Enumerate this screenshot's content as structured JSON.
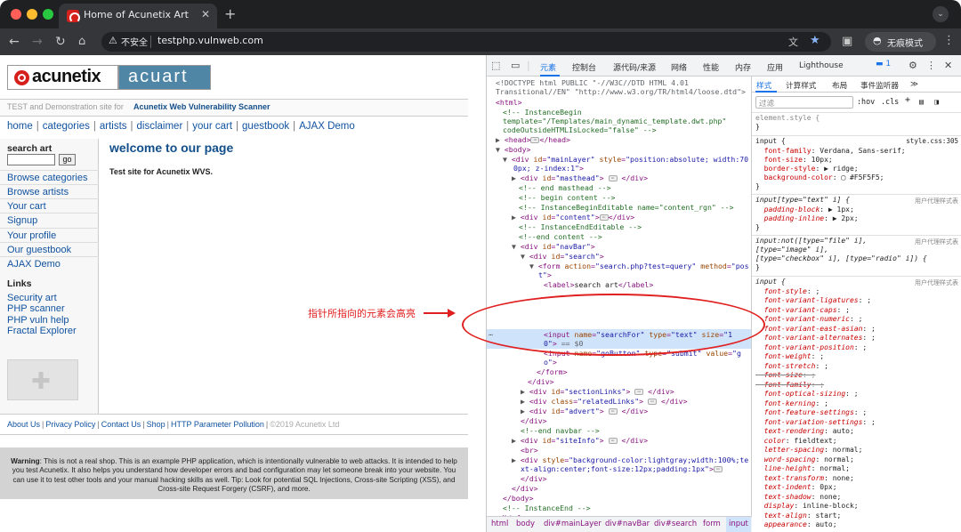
{
  "browser": {
    "tab_title": "Home of Acunetix Art",
    "insecure_label": "不安全",
    "url": "testphp.vulnweb.com",
    "incognito_label": "无痕模式",
    "icons": {
      "back": "back-icon",
      "forward": "forward-icon",
      "reload": "reload-icon",
      "home": "home-icon",
      "warning": "warning-icon",
      "translate": "translate-icon",
      "star": "star-icon",
      "side_panel": "side-panel-icon",
      "incognito": "incognito-icon",
      "menu": "menu-icon",
      "close": "close-icon",
      "new_tab": "plus-icon",
      "tab_dropdown": "chevron-down-icon"
    }
  },
  "site": {
    "logo_left": "acunetix",
    "logo_right": "acuart",
    "tagline_a": "TEST and Demonstration site for",
    "tagline_b": "Acunetix Web Vulnerability Scanner",
    "topnav": [
      "home",
      "categories",
      "artists",
      "disclaimer",
      "your cart",
      "guestbook",
      "AJAX Demo"
    ],
    "search_label": "search art",
    "go_label": "go",
    "sidebar": [
      "Browse categories",
      "Browse artists",
      "Your cart",
      "Signup",
      "Your profile",
      "Our guestbook",
      "AJAX Demo"
    ],
    "links_title": "Links",
    "links": [
      "Security art",
      "PHP scanner",
      "PHP vuln help",
      "Fractal Explorer"
    ],
    "welcome": "welcome to our page",
    "test_site": "Test site for Acunetix WVS.",
    "footer": [
      "About Us",
      "Privacy Policy",
      "Contact Us",
      "Shop",
      "HTTP Parameter Pollution"
    ],
    "copyright": "©2019 Acunetix Ltd",
    "warning_title": "Warning",
    "warning_text": ": This is not a real shop. This is an example PHP application, which is intentionally vulnerable to web attacks. It is intended to help you test Acunetix. It also helps you understand how developer errors and bad configuration may let someone break into your website. You can use it to test other tools and your manual hacking skills as well. Tip: Look for potential SQL Injections, Cross-site Scripting (XSS), and Cross-site Request Forgery (CSRF), and more."
  },
  "devtools": {
    "tabs": [
      "元素",
      "控制台",
      "源代码/来源",
      "网络",
      "性能",
      "内存",
      "应用",
      "Lighthouse"
    ],
    "message_count": "1",
    "crumbs": [
      "html",
      "body",
      "div#mainLayer",
      "div#navBar",
      "div#search",
      "form",
      "input"
    ],
    "styles_tabs": [
      "样式",
      "计算样式",
      "布局",
      "事件监听器"
    ],
    "filter_placeholder": "过滤",
    "hov": ":hov",
    "cls": ".cls",
    "style_source": "style.css:305",
    "ua_label": "用户代理样式表"
  },
  "annotation": {
    "text": "指针所指向的元素会高亮"
  }
}
